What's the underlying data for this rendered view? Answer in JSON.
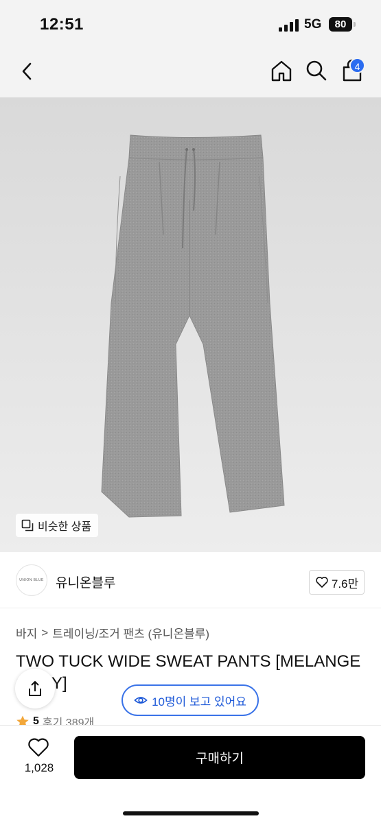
{
  "status_bar": {
    "time": "12:51",
    "network": "5G",
    "battery": "80"
  },
  "nav": {
    "back_icon": "chevron-left-icon",
    "home_icon": "home-icon",
    "search_icon": "search-icon",
    "cart_icon": "shopping-bag-icon",
    "cart_count": "4",
    "badge_color": "#2b6cf0"
  },
  "image": {
    "subject": "grey sweat pants",
    "similar_label": "비슷한 상품"
  },
  "brand": {
    "logo_text": "UNION BLUE",
    "name": "유니온블루",
    "likes": "7.6만"
  },
  "breadcrumb": {
    "category": "바지",
    "separator": ">",
    "subcategory": "트레이닝/조거 팬츠 (유니온블루)"
  },
  "product": {
    "title": "TWO TUCK WIDE SWEAT PANTS [MELANGE GREY]"
  },
  "viewers": {
    "label": "10명이 보고 있어요",
    "accent": "#3a73e8"
  },
  "rating": {
    "score": "5",
    "reviews": "후기 389개"
  },
  "bottom": {
    "wish_count": "1,028",
    "buy_label": "구매하기"
  }
}
